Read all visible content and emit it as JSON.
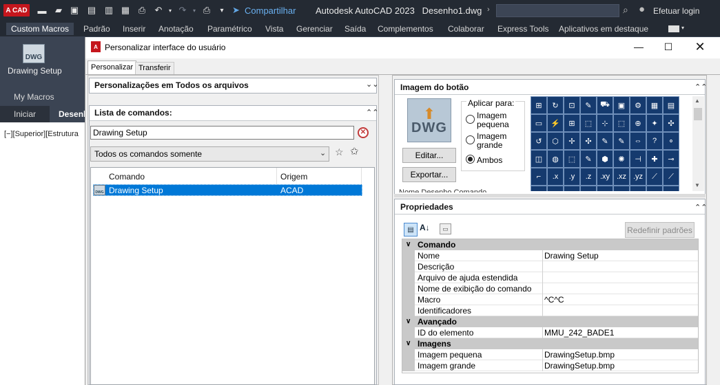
{
  "titlebar": {
    "logo_text": "A CAD",
    "share_label": "Compartilhar",
    "app_title": "Autodesk AutoCAD 2023   Desenho1.dwg",
    "login_label": "Efetuar login"
  },
  "ribbon": {
    "tabs": [
      "Custom Macros",
      "Padrão",
      "Inserir",
      "Anotação",
      "Paramétrico",
      "Vista",
      "Gerenciar",
      "Saída",
      "Complementos",
      "Colaborar",
      "Express Tools",
      "Aplicativos em destaque"
    ],
    "button_icon_text": "DWG",
    "button_label": "Drawing Setup",
    "panel_label": "My Macros"
  },
  "filetabs": {
    "iniciar": "Iniciar",
    "current": "Desenh"
  },
  "viewport": {
    "label": "[−][Superior][Estrutura"
  },
  "dialog": {
    "title": "Personalizar interface do usuário",
    "tabs": {
      "personalizar": "Personalizar",
      "transferir": "Transferir"
    },
    "left": {
      "customizations_title": "Personalizações em Todos os arquivos",
      "list_title": "Lista de comandos:",
      "search_value": "Drawing Setup",
      "filter_value": "Todos os comandos somente",
      "columns": {
        "command": "Comando",
        "origin": "Origem"
      },
      "rows": [
        {
          "icon_text": "DWG",
          "command": "Drawing Setup",
          "origin": "ACAD"
        }
      ]
    },
    "right": {
      "image_section_title": "Imagem do botão",
      "preview_text": "DWG",
      "edit_button": "Editar...",
      "export_button": "Exportar...",
      "apply_title": "Aplicar para:",
      "apply_small": "Imagem pequena",
      "apply_large": "Imagem grande",
      "apply_both": "Ambos",
      "apply_selected": "Ambos",
      "cut_text": "Nome Desenho Comando",
      "grid_icons": [
        "⊞",
        "↻",
        "⊡",
        "✎",
        "⛟",
        "▣",
        "⚙",
        "▦",
        "▤",
        "▭",
        "⚡",
        "⊞",
        "⬚",
        "⊹",
        "⬚",
        "⊕",
        "✦",
        "✣",
        "↺",
        "⬡",
        "✢",
        "✣",
        "✎",
        "✎",
        "⇔",
        "?",
        "⚬",
        "◫",
        "◍",
        "⬚",
        "✎",
        "⬢",
        "✺",
        "⊣",
        "✚",
        "⊸",
        "⌐",
        ".x",
        ".y",
        ".z",
        ".xy",
        ".xz",
        ".yz",
        "⟋",
        "⟋",
        "✕",
        "✕",
        "⋯",
        "◎",
        "◌",
        "⊙",
        "⟋",
        "◻",
        "⊣"
      ],
      "properties_title": "Propriedades",
      "reset_button": "Redefinir padrões",
      "props": [
        {
          "type": "cat",
          "label": "Comando"
        },
        {
          "type": "item",
          "key": "Nome",
          "value": "Drawing Setup"
        },
        {
          "type": "item",
          "key": "Descrição",
          "value": ""
        },
        {
          "type": "item",
          "key": "Arquivo de ajuda estendida",
          "value": ""
        },
        {
          "type": "item",
          "key": "Nome de exibição do comando",
          "value": ""
        },
        {
          "type": "item",
          "key": "Macro",
          "value": "^C^C"
        },
        {
          "type": "item",
          "key": "Identificadores",
          "value": ""
        },
        {
          "type": "cat",
          "label": "Avançado"
        },
        {
          "type": "item",
          "key": "ID do elemento",
          "value": "MMU_242_BADE1"
        },
        {
          "type": "cat",
          "label": "Imagens"
        },
        {
          "type": "item",
          "key": "Imagem pequena",
          "value": "DrawingSetup.bmp"
        },
        {
          "type": "item",
          "key": "Imagem grande",
          "value": "DrawingSetup.bmp"
        }
      ]
    }
  }
}
